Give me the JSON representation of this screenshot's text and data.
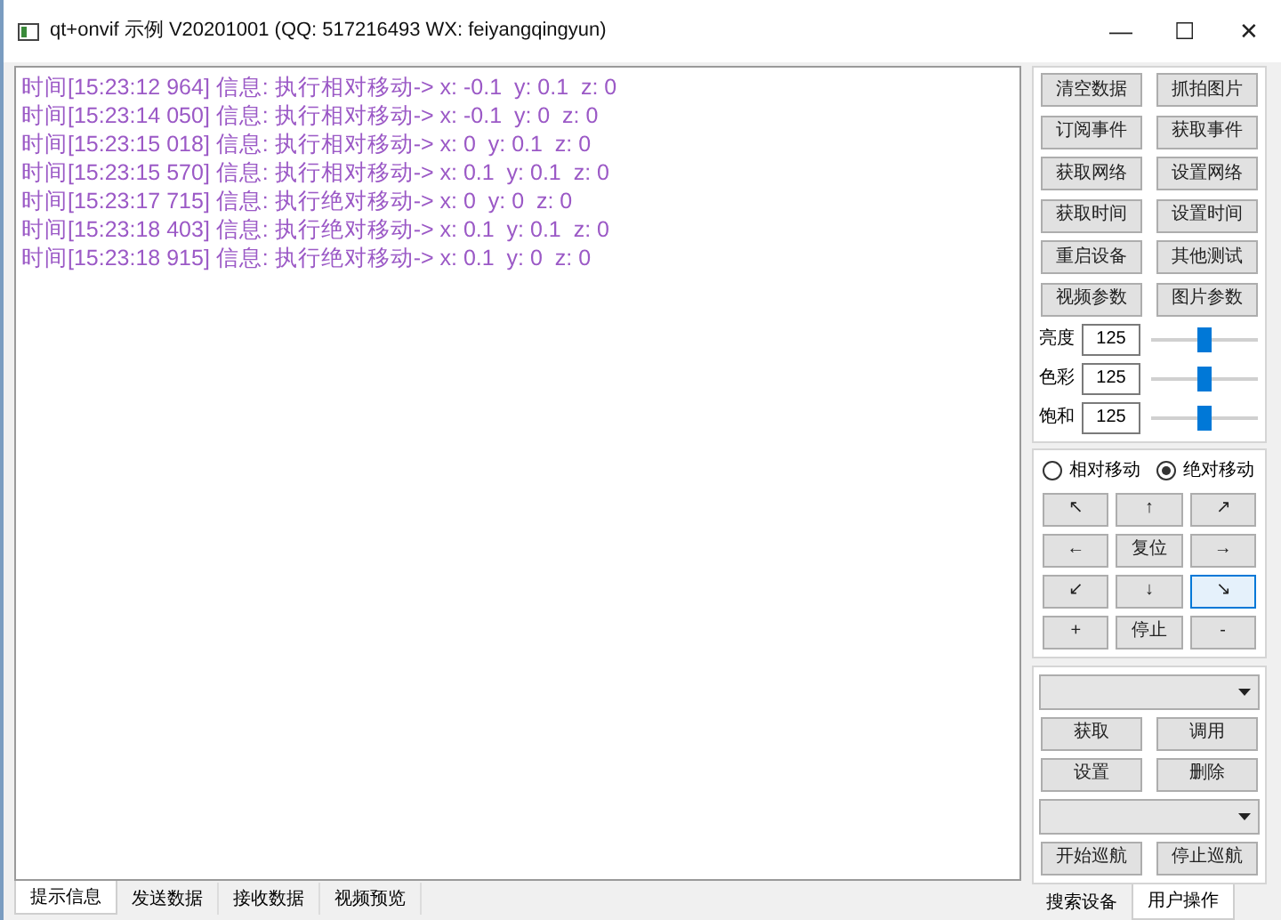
{
  "window": {
    "title": "qt+onvif 示例 V20201001 (QQ: 517216493 WX: feiyangqingyun)",
    "controls": [
      "—",
      "☐",
      "✕"
    ]
  },
  "log": [
    "时间[15:23:12 964] 信息: 执行相对移动-> x: -0.1  y: 0.1  z: 0",
    "时间[15:23:14 050] 信息: 执行相对移动-> x: -0.1  y: 0  z: 0",
    "时间[15:23:15 018] 信息: 执行相对移动-> x: 0  y: 0.1  z: 0",
    "时间[15:23:15 570] 信息: 执行相对移动-> x: 0.1  y: 0.1  z: 0",
    "时间[15:23:17 715] 信息: 执行绝对移动-> x: 0  y: 0  z: 0",
    "时间[15:23:18 403] 信息: 执行绝对移动-> x: 0.1  y: 0.1  z: 0",
    "时间[15:23:18 915] 信息: 执行绝对移动-> x: 0.1  y: 0  z: 0"
  ],
  "bottom_tabs": [
    {
      "label": "提示信息",
      "selected": true
    },
    {
      "label": "发送数据",
      "selected": false
    },
    {
      "label": "接收数据",
      "selected": false
    },
    {
      "label": "视频预览",
      "selected": false
    }
  ],
  "action_buttons": [
    "清空数据",
    "抓拍图片",
    "订阅事件",
    "获取事件",
    "获取网络",
    "设置网络",
    "获取时间",
    "设置时间",
    "重启设备",
    "其他测试",
    "视频参数",
    "图片参数"
  ],
  "sliders": [
    {
      "label": "亮度",
      "value": "125",
      "level": 0.5
    },
    {
      "label": "色彩",
      "value": "125",
      "level": 0.5
    },
    {
      "label": "饱和",
      "value": "125",
      "level": 0.5
    }
  ],
  "move_modes": [
    {
      "label": "相对移动",
      "selected": false
    },
    {
      "label": "绝对移动",
      "selected": true
    }
  ],
  "ptz_buttons": [
    {
      "label": "↖",
      "hovered": false
    },
    {
      "label": "↑",
      "hovered": false
    },
    {
      "label": "↗",
      "hovered": false
    },
    {
      "label": "←",
      "hovered": false
    },
    {
      "label": "复位",
      "hovered": false
    },
    {
      "label": "→",
      "hovered": false
    },
    {
      "label": "↙",
      "hovered": false
    },
    {
      "label": "↓",
      "hovered": false
    },
    {
      "label": "↘",
      "hovered": true
    },
    {
      "label": "+",
      "hovered": false
    },
    {
      "label": "停止",
      "hovered": false
    },
    {
      "label": "-",
      "hovered": false
    }
  ],
  "preset_buttons": [
    "获取",
    "调用",
    "设置",
    "删除"
  ],
  "tour_buttons": [
    "开始巡航",
    "停止巡航"
  ],
  "side_tabs": [
    {
      "label": "搜索设备",
      "selected": false
    },
    {
      "label": "用户操作",
      "selected": true
    }
  ]
}
